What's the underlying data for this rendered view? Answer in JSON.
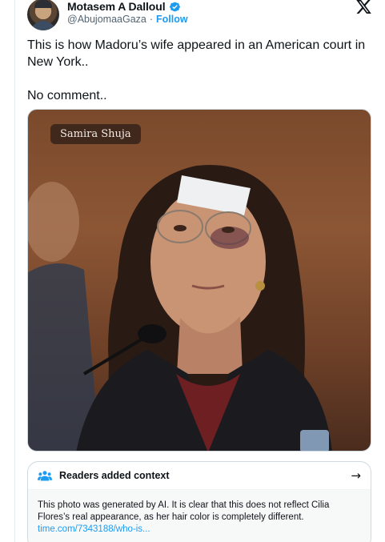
{
  "author": {
    "name": "Motasem A Dalloul",
    "handle": "@AbujomaaGaza",
    "separator": "·",
    "follow_label": "Follow",
    "verified_color": "#1d9bf0"
  },
  "tweet": {
    "line1": "This is how Madoru’s wife appeared in an American court in New York..",
    "line2": "No comment.."
  },
  "media": {
    "watermark": "Samira Shuja"
  },
  "context": {
    "title": "Readers added context",
    "arrow": "→",
    "body": "This photo was generated by AI. It is clear that this does not reflect Cilia Flores’s real appearance, as her hair color is completely different.",
    "link": "time.com/7343188/who-is..."
  },
  "icons": {
    "close": "x-logo-icon",
    "verified": "verified-badge-icon",
    "context": "community-notes-icon",
    "arrow": "arrow-right-icon"
  }
}
